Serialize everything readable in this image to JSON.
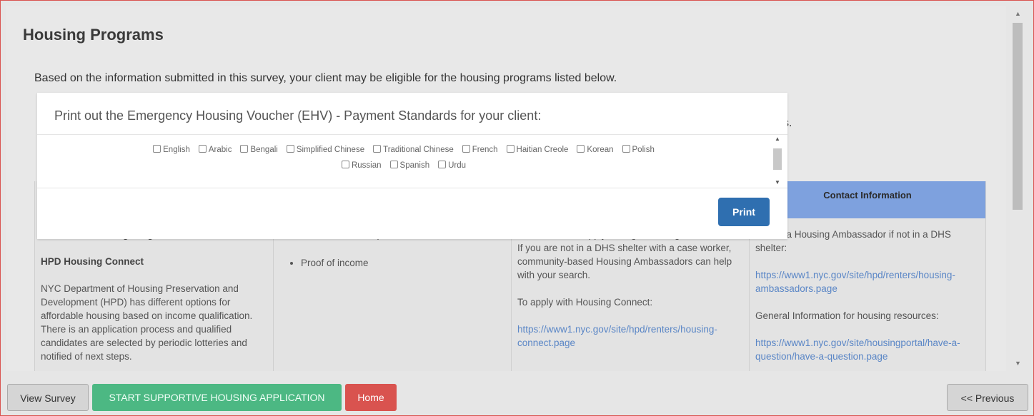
{
  "page": {
    "title": "Housing Programs",
    "intro": "Based on the information submitted in this survey, your client may be eligible for the housing programs listed below.",
    "intro_tail": "s."
  },
  "modal": {
    "title": "Print out the Emergency Housing Voucher (EHV) - Payment Standards for your client:",
    "languages_row1": [
      "English",
      "Arabic",
      "Bengali",
      "Simplified Chinese",
      "Traditional Chinese",
      "French",
      "Haitian Creole",
      "Korean",
      "Polish"
    ],
    "languages_row2": [
      "Russian",
      "Spanish",
      "Urdu"
    ],
    "print_label": "Print"
  },
  "table": {
    "contact_header": "Contact Information",
    "col1": {
      "partial_top": "NYC/State Housing Programs",
      "heading": "HPD Housing Connect",
      "paragraph": "NYC Department of Housing Preservation and Development (HPD) has different options for affordable housing based on income qualification. There is an application process and qualified candidates are selected by periodic lotteries and notified of next steps."
    },
    "col2": {
      "partial_top": "Proof of citizenship",
      "item2": "Proof of income"
    },
    "col3": {
      "partial_top": "For HPD units, apply through Housing Connect.",
      "para1": "If you are not in a DHS shelter with a case worker, community-based Housing Ambassadors can help with your search.",
      "para2": "To apply with Housing Connect:",
      "link": "https://www1.nyc.gov/site/hpd/renters/housing-connect.page"
    },
    "col4": {
      "para1": "To find a Housing Ambassador if not in a DHS shelter:",
      "link1": "https://www1.nyc.gov/site/hpd/renters/housing-ambassadors.page",
      "para2": "General Information for housing resources:",
      "link2": "https://www1.nyc.gov/site/housingportal/have-a-question/have-a-question.page"
    }
  },
  "footer": {
    "view_survey": "View Survey",
    "start": "START SUPPORTIVE HOUSING APPLICATION",
    "home": "Home",
    "previous": "<< Previous"
  },
  "colors": {
    "print_button": "#2f6fb0",
    "start_button": "#4cb883",
    "home_button": "#d9534f",
    "header_blue": "#7ea1de"
  }
}
